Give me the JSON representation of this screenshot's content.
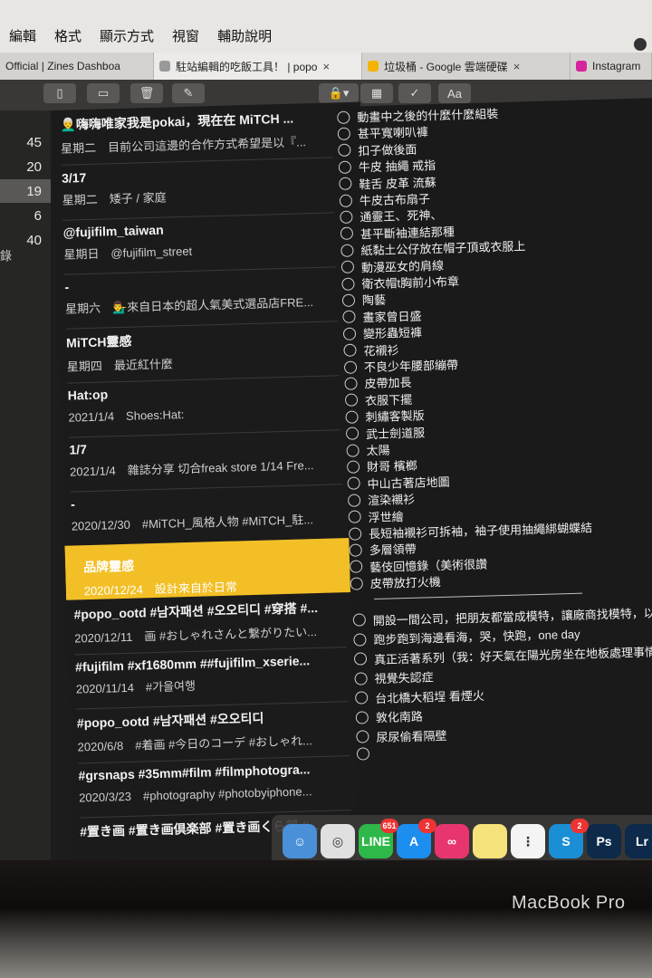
{
  "menu": [
    "編輯",
    "格式",
    "顯示方式",
    "視窗",
    "輔助說明"
  ],
  "tabs": [
    {
      "label": "Official | Zines Dashboa",
      "close": "×",
      "color": "#6a6a6a"
    },
    {
      "label": "駐站編輯的吃飯工具！ | popo",
      "close": "×",
      "color": "#888888"
    },
    {
      "label": "垃圾桶 - Google 雲端硬碟",
      "close": "×",
      "color": "#f4b400"
    },
    {
      "label": "Instagram",
      "close": "",
      "color": "#d6249f"
    }
  ],
  "toolbar": {
    "sidebar_icon": "sidebar-icon",
    "gallery_icon": "gallery-icon",
    "trash_icon": "trash-icon",
    "compose_icon": "compose-icon",
    "lock_icon": "lock-icon",
    "table_icon": "table-icon",
    "checklist_icon": "checklist-icon",
    "format_label": "Aa"
  },
  "sidebar": {
    "prefix": "錄",
    "counts": [
      "45",
      "20",
      "19",
      "6",
      "40"
    ],
    "selected_index": 2
  },
  "notes": [
    {
      "title": "👨‍🦳嗨嗨唯家我是pokai，現在在 MiTCH ...",
      "detail": "星期二　目前公司這邊的合作方式希望是以『..."
    },
    {
      "title": "3/17",
      "detail": "星期二　矮子 / 家庭"
    },
    {
      "title": "@fujifilm_taiwan",
      "detail": "星期日　@fujifilm_street"
    },
    {
      "title": "-",
      "detail": "星期六　💁‍♂️來自日本的超人氣美式選品店FRE..."
    },
    {
      "title": "MiTCH靈感",
      "detail": "星期四　最近紅什麼"
    },
    {
      "title": "Hat:op",
      "detail": "2021/1/4　Shoes:Hat:"
    },
    {
      "title": "1/7",
      "detail": "2021/1/4　雜誌分享 切合freak store 1/14 Fre..."
    },
    {
      "title": "-",
      "detail": "2020/12/30　#MiTCH_風格人物 #MiTCH_駐..."
    },
    {
      "title": "品牌靈感",
      "detail": "2020/12/24　設計來自於日常"
    },
    {
      "title": "#popo_ootd #남자패션 #오오티디 #穿搭 #...",
      "detail": "2020/12/11　画 #おしゃれさんと繋がりたい..."
    },
    {
      "title": "#fujifilm #xf1680mm ##fujifilm_xserie...",
      "detail": "2020/11/14　#가을여행"
    },
    {
      "title": "#popo_ootd #남자패션 #오오티디",
      "detail": "2020/6/8　#着画 #今日のコーデ #おしゃれ..."
    },
    {
      "title": "#grsnaps #35mm#film #filmphotogra...",
      "detail": "2020/3/23　#photography #photobyiphone..."
    },
    {
      "title": "#置き画 #置き画倶楽部 #置き画くら部 #...",
      "detail": ""
    }
  ],
  "selected_note_index": 8,
  "checklist_a": [
    "動畫中之後的什麼什麼組裝",
    "甚平寬喇叭褲",
    "扣子做後面",
    "牛皮 抽繩 戒指",
    "鞋舌 皮革 流蘇",
    "牛皮古布扇子",
    "通靈王、死神、",
    "甚平斷袖連結那種",
    "紙黏土公仔放在帽子頂或衣服上",
    "動漫巫女的肩線",
    "衛衣帽t胸前小布章",
    "陶藝",
    "畫家曾日盛",
    "變形蟲短褲",
    "花襯衫",
    "不良少年腰部繃帶",
    "皮帶加長",
    "衣服下擺",
    "刺繡客製版",
    "武士劍道服",
    "太陽",
    "財哥 檳榔",
    "中山古著店地圖",
    "渲染襯衫",
    "浮世繪",
    "長短袖襯衫可拆袖，袖子使用抽繩綁蝴蝶結",
    "多層領帶",
    "藝伎回憶錄（美術很讚",
    "皮帶放打火機"
  ],
  "checklist_b": [
    "開設一間公司，把朋友都當成模特，讓廠商找模特，以粉",
    "跑步跑到海邊看海，哭，快跑，one day",
    "真正活著系列（我：好天氣在陽光房坐在地板處理事情陳",
    "視覺失認症",
    "台北橋大稻埕 看煙火",
    "敦化南路",
    "尿尿偷看隔壁",
    ""
  ],
  "dock": [
    {
      "name": "finder",
      "label": "☺",
      "color": "#4a90d9",
      "badge": ""
    },
    {
      "name": "chrome",
      "label": "◎",
      "color": "#e0e0e0",
      "badge": ""
    },
    {
      "name": "line",
      "label": "LINE",
      "color": "#2fb84a",
      "badge": "651"
    },
    {
      "name": "app-store",
      "label": "A",
      "color": "#1c8ef0",
      "badge": "2"
    },
    {
      "name": "creative-cloud",
      "label": "∞",
      "color": "#e8356e",
      "badge": ""
    },
    {
      "name": "notes",
      "label": "",
      "color": "#f5e27a",
      "badge": ""
    },
    {
      "name": "reminders",
      "label": "⋮",
      "color": "#f4f4f4",
      "badge": ""
    },
    {
      "name": "skype",
      "label": "S",
      "color": "#1a8fd6",
      "badge": "2"
    },
    {
      "name": "photoshop",
      "label": "Ps",
      "color": "#0d2a4a",
      "badge": ""
    },
    {
      "name": "lightroom",
      "label": "Lr",
      "color": "#0d2a4a",
      "badge": ""
    }
  ],
  "brand": "MacBook Pro",
  "colors": {
    "accent": "#f2bf26",
    "background": "#1b1b1b"
  }
}
